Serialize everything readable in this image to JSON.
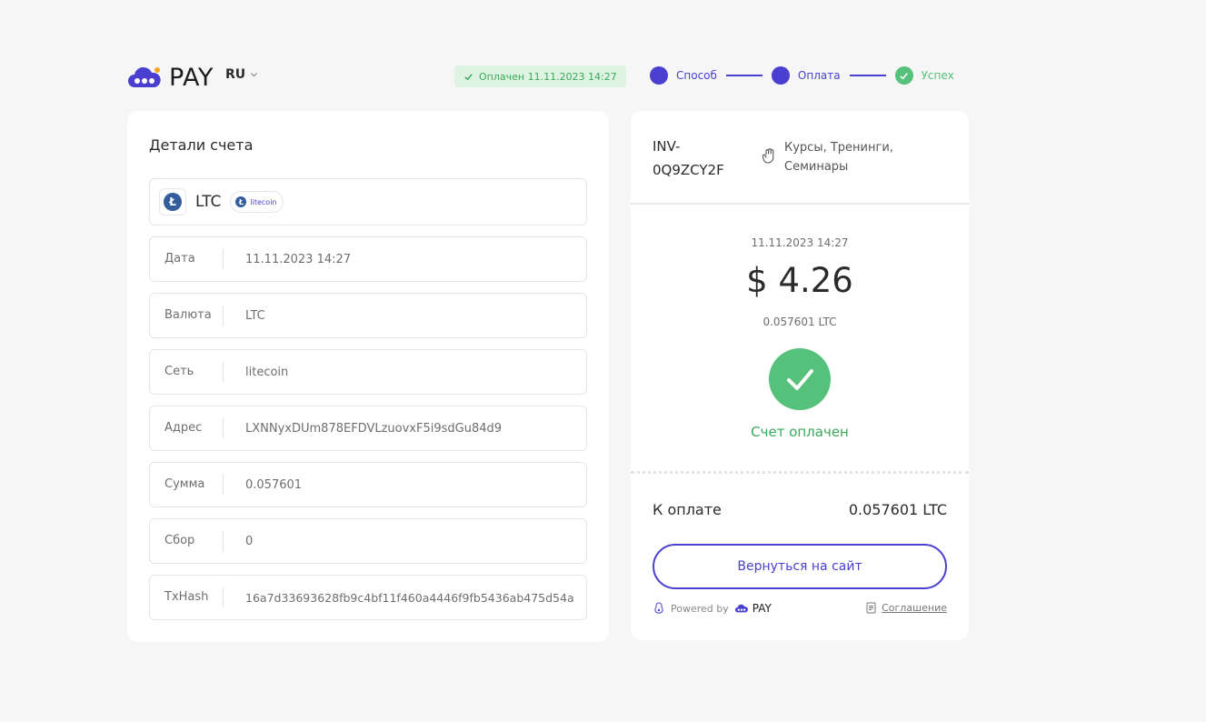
{
  "header": {
    "logo_text": "PAY",
    "language": "RU",
    "paid_badge": "Оплачен 11.11.2023 14:27"
  },
  "steps": [
    {
      "label": "Способ",
      "state": "done"
    },
    {
      "label": "Оплата",
      "state": "done"
    },
    {
      "label": "Успех",
      "state": "success"
    }
  ],
  "details": {
    "title": "Детали счета",
    "coin": {
      "symbol": "LTC",
      "network_badge": "litecoin"
    },
    "rows": [
      {
        "label": "Дата",
        "value": "11.11.2023 14:27"
      },
      {
        "label": "Валюта",
        "value": "LTC"
      },
      {
        "label": "Сеть",
        "value": "litecoin"
      },
      {
        "label": "Адрес",
        "value": "LXNNyxDUm878EFDVLzuovxF5i9sdGu84d9"
      },
      {
        "label": "Сумма",
        "value": "0.057601"
      },
      {
        "label": "Сбор",
        "value": "0"
      },
      {
        "label": "TxHash",
        "value": "16a7d33693628fb9c4bf11f460a4446f9fb5436ab475d54a"
      }
    ]
  },
  "invoice": {
    "id": "INV-0Q9ZCY2F",
    "category": "Курсы, Тренинги, Семинары",
    "date": "11.11.2023 14:27",
    "amount_fiat": "$ 4.26",
    "amount_crypto": "0.057601 LTC",
    "status_text": "Счет оплачен",
    "total_label": "К оплате",
    "total_value": "0.057601 LTC",
    "back_button": "Вернуться на сайт",
    "powered_by": "Powered by",
    "powered_logo": "PAY",
    "agreement": "Соглашение"
  },
  "colors": {
    "accent": "#4a3fd1",
    "success": "#55c17a",
    "background": "#f6f6f6"
  },
  "icons": {
    "logo": "cloud-logo-icon",
    "check": "check-icon",
    "category": "hand-icon",
    "agreement": "document-icon"
  }
}
